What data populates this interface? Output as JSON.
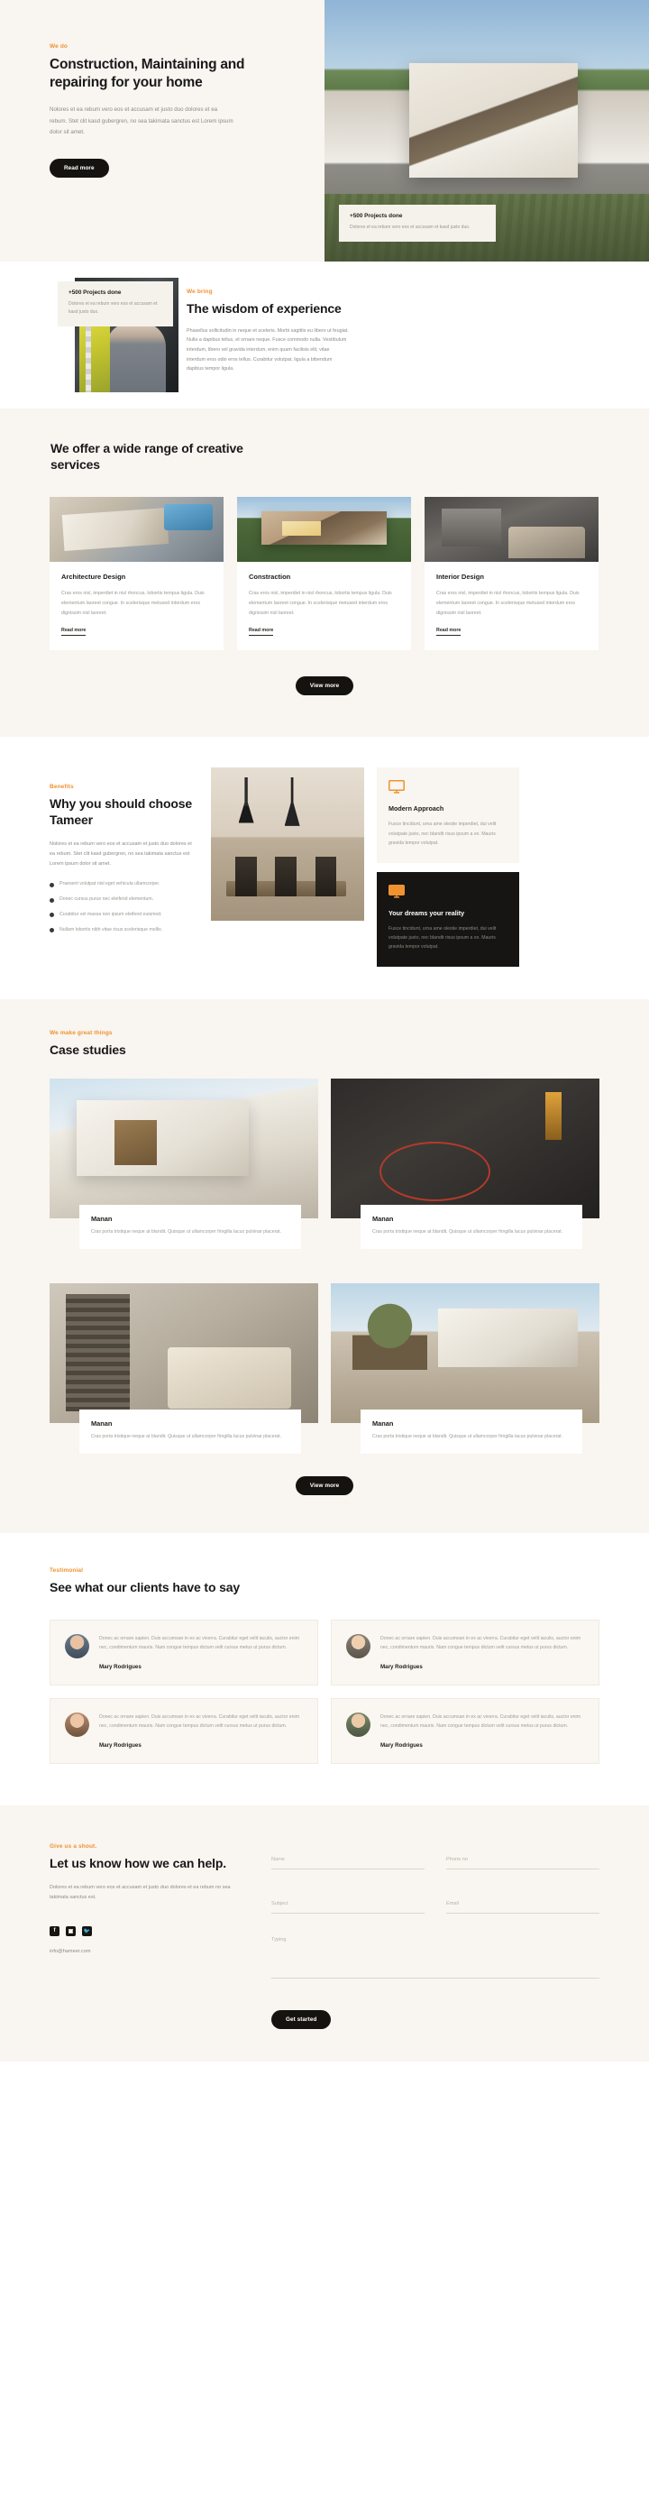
{
  "brand": {
    "accent": "#f0922f",
    "dark": "#15130f",
    "cream": "#f9f5f0"
  },
  "hero": {
    "eyebrow": "We do",
    "title": "Construction, Maintaining and repairing for your home",
    "paragraph": "Nolores et ea rebum vero eos et accusam et justo duo dolores et ea rebum. Stet clit kasd gubergren, no sea takimata sanctus est Lorem ipsum dolor sit amet.",
    "cta": "Read more",
    "badge": {
      "title": "+500 Projects done",
      "text": "Dolores et ea rebum vero eos et accusam et kasd justo duo."
    }
  },
  "wisdom": {
    "eyebrow": "We bring",
    "title": "The wisdom of experience",
    "paragraph": "Phasellus sollicitudin in neque et sceleris. Morbi sagittis eu libero ut feugiat. Nulla a dapibus tellus, et ornare neque. Fusce commodo nulla. Vestibulum interdum, libero vel gravida interdum, enim quam facilisis elit, vitae interdum eros odio eros tellus. Curabitur volutpat, ligula a bibendum dapibus tempor ligula.",
    "badge": {
      "title": "+500 Projects done",
      "text": "Dolores et ea rebum vero eos et accusam et kasd justo duo."
    }
  },
  "services": {
    "title": "We offer a wide range of creative services",
    "cta": "View more",
    "cards": [
      {
        "title": "Architecture Design",
        "text": "Cras eros nisl, imperdiet in nisl rhoncus, lobortis tempus ligula. Duis elementum laoreet congue. In scelerisque metused interdum eros dignissim nisl laoreet.",
        "link": "Read more",
        "image": "architecture-desk-photo"
      },
      {
        "title": "Constraction",
        "text": "Cras eros nisl, imperdiet in nisl rhoncus, lobortis tempus ligula. Duis elementum laoreet congue. In scelerisque metused interdum eros dignissim nisl laoreet.",
        "link": "Read more",
        "image": "modern-house-photo"
      },
      {
        "title": "Interior Design",
        "text": "Cras eros nisl, imperdiet in nisl rhoncus, lobortis tempus ligula. Duis elementum laoreet congue. In scelerisque metused interdum eros dignissim nisl laoreet.",
        "link": "Read more",
        "image": "interior-room-photo"
      }
    ]
  },
  "benefits": {
    "eyebrow": "Benefits",
    "title": "Why you should choose Tameer",
    "paragraph": "Nolores et ea rebum vero eos et accusam et justo duo dolores et ea rebum. Stet clit kasd gubergren, no sea takimata sanctus est Lorem ipsum dolor sit amet.",
    "bullets": [
      "Praesent volutpat nisl eget vehicula ullamcorper.",
      "Donec cursus purus nec eleifend elementum.",
      "Curabitur vel massa non ipsum eleifend euismod.",
      "Nullam lobortis nibh vitae risus scelerisque mollis."
    ],
    "cards": [
      {
        "icon": "monitor-icon",
        "title": "Modern Approach",
        "text": "Fusce tincidunt, urna ame olestie imperdiet, dui velit volutpate justo, nec blandit risus ipsum a ex. Mauris gravida tempor volutpat."
      },
      {
        "icon": "monitor-icon",
        "title": "Your dreams your reality",
        "text": "Fusce tincidunt, urna ame olestie imperdiet, dui velit volutpate justo, nec blandit risus ipsum a ex. Mauris gravida tempor volutpat."
      }
    ]
  },
  "cases": {
    "eyebrow": "We make great things",
    "title": "Case studies",
    "cta": "View more",
    "items": [
      {
        "title": "Manan",
        "text": "Cras porta tristique neque at blandit. Quisque ut ullamcorper fringilla lacus pulvinar placerat.",
        "image": "white-villa-photo"
      },
      {
        "title": "Manan",
        "text": "Cras porta tristique neque at blandit. Quisque ut ullamcorper fringilla lacus pulvinar placerat.",
        "image": "dark-loft-photo"
      },
      {
        "title": "Manan",
        "text": "Cras porta tristique neque at blandit. Quisque ut ullamcorper fringilla lacus pulvinar placerat.",
        "image": "living-room-photo"
      },
      {
        "title": "Manan",
        "text": "Cras porta tristique neque at blandit. Quisque ut ullamcorper fringilla lacus pulvinar placerat.",
        "image": "garden-house-photo"
      }
    ]
  },
  "testimonials": {
    "eyebrow": "Testimonial",
    "title": "See what our clients have to say",
    "items": [
      {
        "text": "Donec ac ornare sapien. Duis accumsan in ex ac viverra. Curabitur eget velit iaculis, auctor enim nec, condimentum mauris. Nam congue tempus dictum velit cursus metus ut purus dictum.",
        "name": "Mary  Rodrigues",
        "avatar": "avatar-1"
      },
      {
        "text": "Donec ac ornare sapien. Duis accumsan in ex ac viverra. Curabitur eget velit iaculis, auctor enim nec, condimentum mauris. Nam congue tempus dictum velit cursus metus ut purus dictum.",
        "name": "Mary  Rodrigues",
        "avatar": "avatar-2"
      },
      {
        "text": "Donec ac ornare sapien. Duis accumsan in ex ac viverra. Curabitur eget velit iaculis, auctor enim nec, condimentum mauris. Nam congue tempus dictum velit cursus metus ut purus dictum.",
        "name": "Mary  Rodrigues",
        "avatar": "avatar-3"
      },
      {
        "text": "Donec ac ornare sapien. Duis accumsan in ex ac viverra. Curabitur eget velit iaculis, auctor enim nec, condimentum mauris. Nam congue tempus dictum velit cursus metus ut purus dictum.",
        "name": "Mary  Rodrigues",
        "avatar": "avatar-4"
      }
    ]
  },
  "contact": {
    "eyebrow": "Give us a shout.",
    "title": "Let us know how we can help.",
    "paragraph": "Dolores et ea rebum vero eos et accusam et justo duo dolores et ea rebum no sea takimata sanctus est.",
    "socials": [
      {
        "name": "facebook-icon",
        "glyph": "f"
      },
      {
        "name": "instagram-icon",
        "glyph": "▣"
      },
      {
        "name": "twitter-icon",
        "glyph": "🐦"
      }
    ],
    "email": "info@hameer.com",
    "form": {
      "name_placeholder": "Name",
      "phone_placeholder": "Phone no",
      "subject_placeholder": "Subject",
      "email_placeholder": "Email",
      "message_placeholder": "Typing",
      "submit": "Get started"
    }
  }
}
